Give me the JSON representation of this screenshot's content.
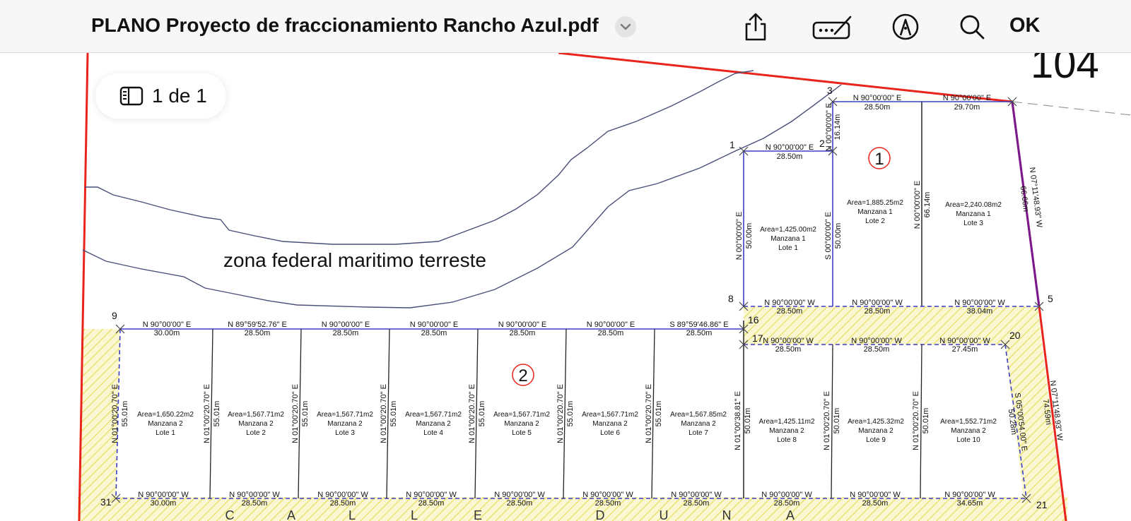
{
  "toolbar": {
    "title": "PLANO Proyecto de fraccionamiento Rancho Azul.pdf",
    "ok_label": "OK"
  },
  "page_indicator": {
    "label": "1 de 1"
  },
  "plan": {
    "corner_number": "104",
    "zone_label": "zona federal maritimo terreste",
    "manzana_markers": [
      "1",
      "2"
    ],
    "points": [
      "1",
      "2",
      "3",
      "5",
      "8",
      "9",
      "16",
      "17",
      "20",
      "21",
      "31"
    ],
    "street_letters": [
      "C",
      "A",
      "L",
      "L",
      "E",
      "D",
      "U",
      "N",
      "A"
    ],
    "m1": {
      "top_edges": [
        {
          "bearing": "N 90°00'00\" E",
          "dist": "28.50m"
        },
        {
          "bearing": "N 90°00'00\" E",
          "dist": "28.50m"
        },
        {
          "bearing": "N 90°00'00\" E",
          "dist": "29.70m"
        }
      ],
      "bottom_edges": [
        {
          "bearing": "N 90°00'00\" W",
          "dist": "28.50m"
        },
        {
          "bearing": "N 90°00'00\" W",
          "dist": "28.50m"
        },
        {
          "bearing": "N 90°00'00\" W",
          "dist": "38.04m"
        }
      ],
      "side_labels": [
        {
          "bearing": "N 00°00'00\" E",
          "dist": "50.00m"
        },
        {
          "bearing": "S 00°00'00\" E",
          "dist": "50.00m"
        },
        {
          "bearing": "N 00°00'00\" E",
          "dist": "66.14m"
        },
        {
          "bearing": "N 00°00'00\" E",
          "dist": "16.14m"
        },
        {
          "bearing": "N 07°11'48.93\" W",
          "dist": "66.66m"
        }
      ],
      "lots": [
        {
          "area": "Area=1,425.00m2",
          "manzana": "Manzana 1",
          "lote": "Lote 1"
        },
        {
          "area": "Area=1,885.25m2",
          "manzana": "Manzana 1",
          "lote": "Lote 2"
        },
        {
          "area": "Area=2,240.08m2",
          "manzana": "Manzana 1",
          "lote": "Lote 3"
        }
      ]
    },
    "m2": {
      "top_edges": [
        {
          "bearing": "N 90°00'00\" E",
          "dist": "30.00m"
        },
        {
          "bearing": "N 89°59'52.76\" E",
          "dist": "28.50m"
        },
        {
          "bearing": "N 90°00'00\" E",
          "dist": "28.50m"
        },
        {
          "bearing": "N 90°00'00\" E",
          "dist": "28.50m"
        },
        {
          "bearing": "N 90°00'00\" E",
          "dist": "28.50m"
        },
        {
          "bearing": "N 90°00'00\" E",
          "dist": "28.50m"
        },
        {
          "bearing": "S 89°59'46.86\" E",
          "dist": "28.50m"
        }
      ],
      "top_edges_right": [
        {
          "bearing": "N 90°00'00\" W",
          "dist": "28.50m"
        },
        {
          "bearing": "N 90°00'00\" W",
          "dist": "28.50m"
        },
        {
          "bearing": "N 90°00'00\" W",
          "dist": "27.45m"
        }
      ],
      "bottom_edges": [
        {
          "bearing": "N 90°00'00\" W",
          "dist": "30.00m"
        },
        {
          "bearing": "N 90°00'00\" W",
          "dist": "28.50m"
        },
        {
          "bearing": "N 90°00'00\" W",
          "dist": "28.50m"
        },
        {
          "bearing": "N 90°00'00\" W",
          "dist": "28.50m"
        },
        {
          "bearing": "N 90°00'00\" W",
          "dist": "28.50m"
        },
        {
          "bearing": "N 90°00'00\" W",
          "dist": "28.50m"
        },
        {
          "bearing": "N 90°00'00\" W",
          "dist": "28.50m"
        },
        {
          "bearing": "N 90°00'00\" W",
          "dist": "28.50m"
        },
        {
          "bearing": "N 90°00'00\" W",
          "dist": "28.50m"
        },
        {
          "bearing": "N 90°00'00\" W",
          "dist": "34.65m"
        }
      ],
      "side_labels": [
        {
          "bearing": "N 01°00'20.70\" E",
          "dist": "55.01m"
        },
        {
          "bearing": "N 01°00'20.70\" E",
          "dist": "55.01m"
        },
        {
          "bearing": "N 01°00'20.70\" E",
          "dist": "55.01m"
        },
        {
          "bearing": "N 01°00'20.70\" E",
          "dist": "55.01m"
        },
        {
          "bearing": "N 01°00'20.70\" E",
          "dist": "55.01m"
        },
        {
          "bearing": "N 01°00'20.70\" E",
          "dist": "55.01m"
        },
        {
          "bearing": "N 01°00'20.70\" E",
          "dist": "55.01m"
        },
        {
          "bearing": "N 01°00'38.81\" E",
          "dist": "50.01m"
        },
        {
          "bearing": "N 01°00'20.70\" E",
          "dist": "50.01m"
        },
        {
          "bearing": "N 01°00'20.70\" E",
          "dist": "50.01m"
        },
        {
          "bearing": "S 05°00'54.00\" E",
          "dist": "50.28m"
        },
        {
          "bearing": "N 07°11'48.93\" W",
          "dist": "74.59m"
        }
      ],
      "lots": [
        {
          "area": "Area=1,650.22m2",
          "manzana": "Manzana 2",
          "lote": "Lote 1"
        },
        {
          "area": "Area=1,567.71m2",
          "manzana": "Manzana 2",
          "lote": "Lote 2"
        },
        {
          "area": "Area=1,567.71m2",
          "manzana": "Manzana 2",
          "lote": "Lote 3"
        },
        {
          "area": "Area=1,567.71m2",
          "manzana": "Manzana 2",
          "lote": "Lote 4"
        },
        {
          "area": "Area=1,567.71m2",
          "manzana": "Manzana 2",
          "lote": "Lote 5"
        },
        {
          "area": "Area=1,567.71m2",
          "manzana": "Manzana 2",
          "lote": "Lote 6"
        },
        {
          "area": "Area=1,567.85m2",
          "manzana": "Manzana 2",
          "lote": "Lote 7"
        },
        {
          "area": "Area=1,425.11m2",
          "manzana": "Manzana 2",
          "lote": "Lote 8"
        },
        {
          "area": "Area=1,425.32m2",
          "manzana": "Manzana 2",
          "lote": "Lote 9"
        },
        {
          "area": "Area=1,552.71m2",
          "manzana": "Manzana 2",
          "lote": "Lote 10"
        }
      ]
    }
  },
  "colors": {
    "boundary": "#e8241c",
    "lot_lines": "#3b3fc4",
    "purple_edge": "#7a1a8f",
    "hatch": "#e9e36a"
  }
}
